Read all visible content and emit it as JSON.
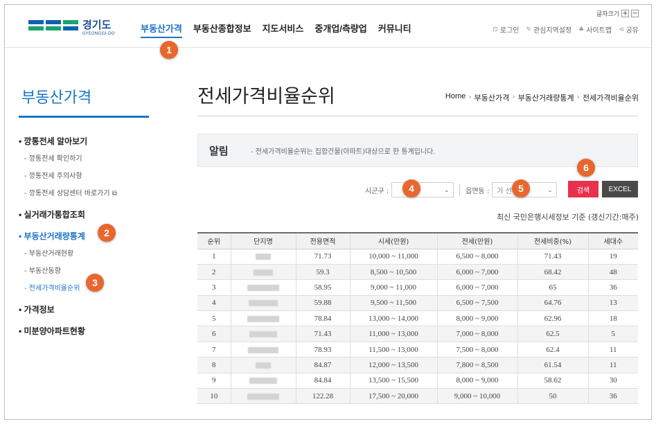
{
  "header": {
    "logo": {
      "ko": "경기도",
      "en": "GYEONGGI-DO"
    },
    "gnb": [
      {
        "label": "부동산가격",
        "active": true
      },
      {
        "label": "부동산종합정보",
        "active": false
      },
      {
        "label": "지도서비스",
        "active": false
      },
      {
        "label": "중개업/측량업",
        "active": false
      },
      {
        "label": "커뮤니티",
        "active": false
      }
    ],
    "font_size_label": "글자크기",
    "font_plus": "+",
    "font_minus": "−",
    "util": [
      "로그인",
      "관심지역설정",
      "사이트맵",
      "공유"
    ]
  },
  "markers": [
    "1",
    "2",
    "3",
    "4",
    "5",
    "6"
  ],
  "sidebar": {
    "title": "부동산가격",
    "menu": [
      {
        "label": "깡통전세 알아보기",
        "level": 1,
        "active": false
      },
      {
        "label": "깡통전세 확인하기",
        "level": 2,
        "active": false
      },
      {
        "label": "깡통전세 주의사항",
        "level": 2,
        "active": false
      },
      {
        "label": "깡통전세 상담센터 바로가기",
        "level": 2,
        "active": false,
        "external": true
      },
      {
        "label": "실거래가통합조회",
        "level": 1,
        "active": false
      },
      {
        "label": "부동산거래량통계",
        "level": 1,
        "active": true
      },
      {
        "label": "부동산거래현황",
        "level": 2,
        "active": false
      },
      {
        "label": "부동산동향",
        "level": 2,
        "active": false
      },
      {
        "label": "전세가격비율순위",
        "level": 2,
        "active": true
      },
      {
        "label": "가격정보",
        "level": 1,
        "active": false
      },
      {
        "label": "미분양아파트현황",
        "level": 1,
        "active": false
      }
    ]
  },
  "main": {
    "title": "전세가격비율순위",
    "breadcrumb": [
      "Home",
      "부동산가격",
      "부동산거래량통계",
      "전세가격비율순위"
    ],
    "notice_label": "알림",
    "notice_text": "- 전세가격비율순위는 집합건물(아파트)대상으로 한 통계입니다.",
    "filters": {
      "sigungu_label": "시군구 :",
      "sigungu_value": "",
      "eupmyeondong_label": "읍면동 :",
      "eupmyeondong_value": "가      선택"
    },
    "search_label": "검색",
    "excel_label": "EXCEL",
    "basis": "최신 국민은행시세정보 기준 (갱신기간:매주)",
    "table": {
      "headers": [
        "순위",
        "단지명",
        "전용면적",
        "시세(만원)",
        "전세(만원)",
        "전세비중(%)",
        "세대수"
      ],
      "rows": [
        [
          "1",
          "",
          "71.73",
          "10,000 ~ 11,000",
          "6,500 ~ 8,000",
          "71.43",
          "19"
        ],
        [
          "2",
          "",
          "59.3",
          "8,500 ~ 10,500",
          "6,000 ~ 7,000",
          "68.42",
          "48"
        ],
        [
          "3",
          "",
          "58.95",
          "9,000 ~ 11,000",
          "6,000 ~ 7,000",
          "65",
          "36"
        ],
        [
          "4",
          "",
          "59.88",
          "9,500 ~ 11,500",
          "6,500 ~ 7,500",
          "64.76",
          "13"
        ],
        [
          "5",
          "",
          "78.84",
          "13,000 ~ 14,000",
          "8,000 ~ 9,000",
          "62.96",
          "18"
        ],
        [
          "6",
          "",
          "71.43",
          "11,000 ~ 13,000",
          "7,000 ~ 8,000",
          "62.5",
          "5"
        ],
        [
          "7",
          "",
          "78.93",
          "11,500 ~ 13,000",
          "7,500 ~ 8,000",
          "62.4",
          "11"
        ],
        [
          "8",
          "",
          "84.87",
          "12,000 ~ 13,500",
          "7,800 ~ 8,500",
          "61.54",
          "11"
        ],
        [
          "9",
          "",
          "84.84",
          "13,500 ~ 15,500",
          "8,000 ~ 9,000",
          "58.62",
          "30"
        ],
        [
          "10",
          "",
          "122.28",
          "17,500 ~ 20,000",
          "9,000 ~ 10,000",
          "50",
          "36"
        ]
      ]
    }
  },
  "colors": {
    "accent": "#1a73c8",
    "marker": "#e8672e",
    "search": "#e8314f",
    "excel": "#4a4a4a"
  }
}
